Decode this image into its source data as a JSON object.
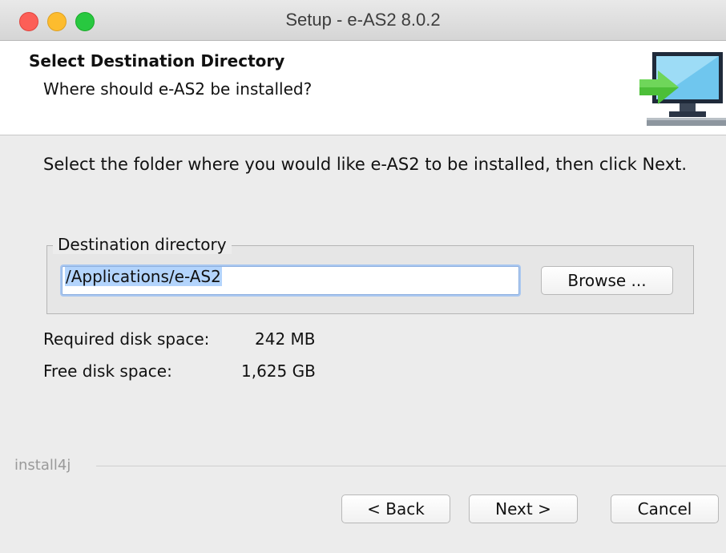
{
  "window": {
    "title": "Setup - e-AS2 8.0.2"
  },
  "header": {
    "title": "Select Destination Directory",
    "subtitle": "Where should e-AS2 be installed?",
    "icon": "install-monitor-icon"
  },
  "instructions": "Select the folder where you would like e-AS2 to be installed, then click Next.",
  "destination": {
    "legend": "Destination directory",
    "path": "/Applications/e-AS2",
    "browse_label": "Browse ..."
  },
  "disk": {
    "required_label": "Required disk space:",
    "required_value": "242 MB",
    "free_label": "Free disk space:",
    "free_value": "1,625 GB"
  },
  "footer": {
    "brand": "install4j",
    "back_label": "< Back",
    "next_label": "Next >",
    "cancel_label": "Cancel"
  },
  "colors": {
    "close": "#fc5f57",
    "minimize": "#fdbc2e",
    "maximize": "#28c840",
    "selection": "#b3d4fc",
    "focus_ring": "#a9c7f0"
  }
}
